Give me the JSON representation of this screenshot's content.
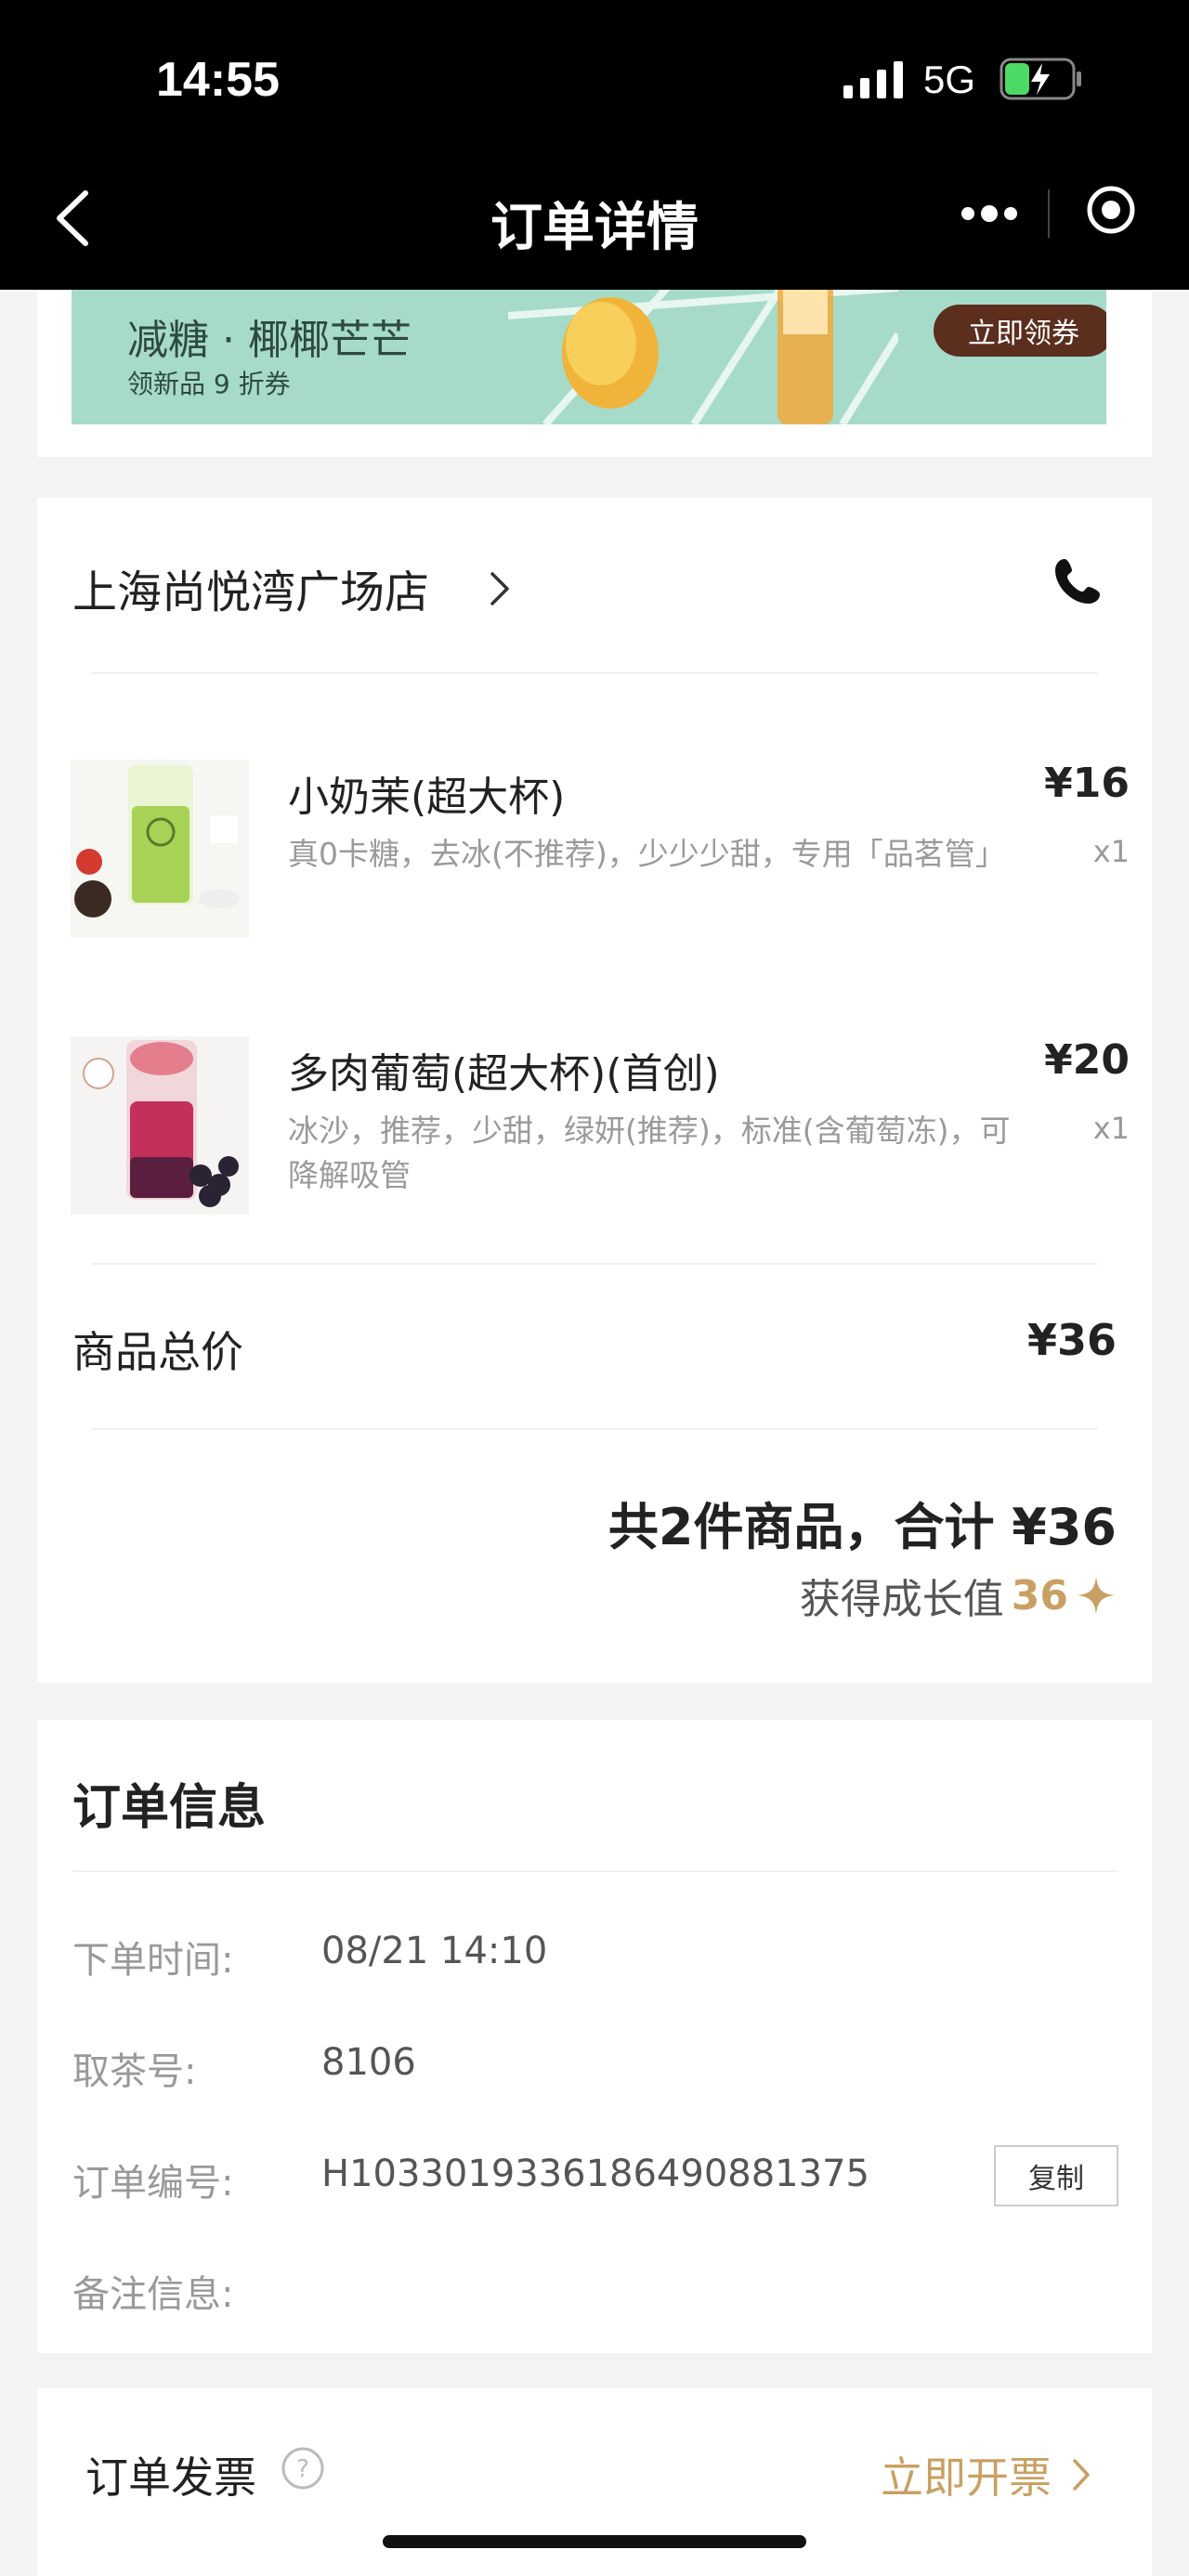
{
  "status_bar": {
    "time": "14:55",
    "network": "5G"
  },
  "nav": {
    "title": "订单详情",
    "icons": [
      "back-icon",
      "more-icon",
      "target-icon"
    ]
  },
  "promo": {
    "line1": "减糖 · 椰椰芒芒",
    "line2": "领新品 9 折券",
    "cta": "立即领券",
    "colors": {
      "banner": "#a6dbc9",
      "cta_bg": "#5b2e1e"
    }
  },
  "store": {
    "name": "上海尚悦湾广场店",
    "products": [
      {
        "name": "小奶茉(超大杯)",
        "spec": "真0卡糖，去冰(不推荐)，少少少甜，专用「品茗管」",
        "price": "¥16",
        "qty": "x1",
        "thumb_icon": "milk-tea-thumb"
      },
      {
        "name": "多肉葡萄(超大杯)(首创)",
        "spec": "冰沙，推荐，少甜，绿妍(推荐)，标准(含葡萄冻)，可降解吸管",
        "price": "¥20",
        "qty": "x1",
        "thumb_icon": "grape-tea-thumb"
      }
    ],
    "subtotal_label": "商品总价",
    "subtotal_value": "¥36",
    "total_text": "共2件商品，合计 ¥36",
    "growth_label": "获得成长值",
    "growth_value": "36"
  },
  "order_info": {
    "title": "订单信息",
    "rows": [
      {
        "label": "下单时间:",
        "value": "08/21 14:10"
      },
      {
        "label": "取茶号:",
        "value": "8106"
      },
      {
        "label": "订单编号:",
        "value": "H1033019336186490881375"
      },
      {
        "label": "备注信息:",
        "value": ""
      }
    ],
    "copy_label": "复制"
  },
  "invoice": {
    "label": "订单发票",
    "cta": "立即开票"
  },
  "colors": {
    "accent_gold": "#c9a063",
    "header_bg": "#000000",
    "page_bg": "#f3f3f3"
  }
}
